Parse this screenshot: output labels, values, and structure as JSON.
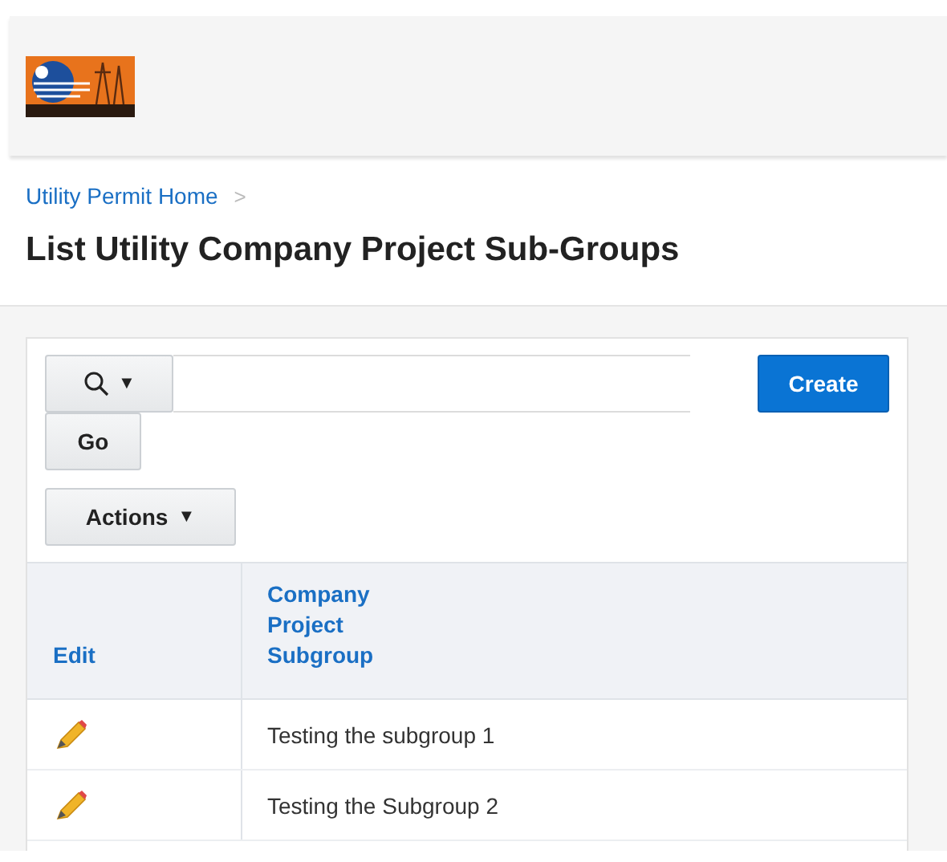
{
  "breadcrumb": {
    "link": "Utility Permit Home",
    "separator": ">"
  },
  "title": "List Utility Company Project Sub-Groups",
  "toolbar": {
    "search_caret": "▼",
    "go": "Go",
    "actions": "Actions",
    "actions_caret": "▼",
    "create": "Create"
  },
  "table": {
    "columns": [
      "Edit",
      "Company Project Subgroup"
    ],
    "rows": [
      {
        "subgroup": "Testing the subgroup 1"
      },
      {
        "subgroup": "Testing the Subgroup 2"
      }
    ]
  }
}
